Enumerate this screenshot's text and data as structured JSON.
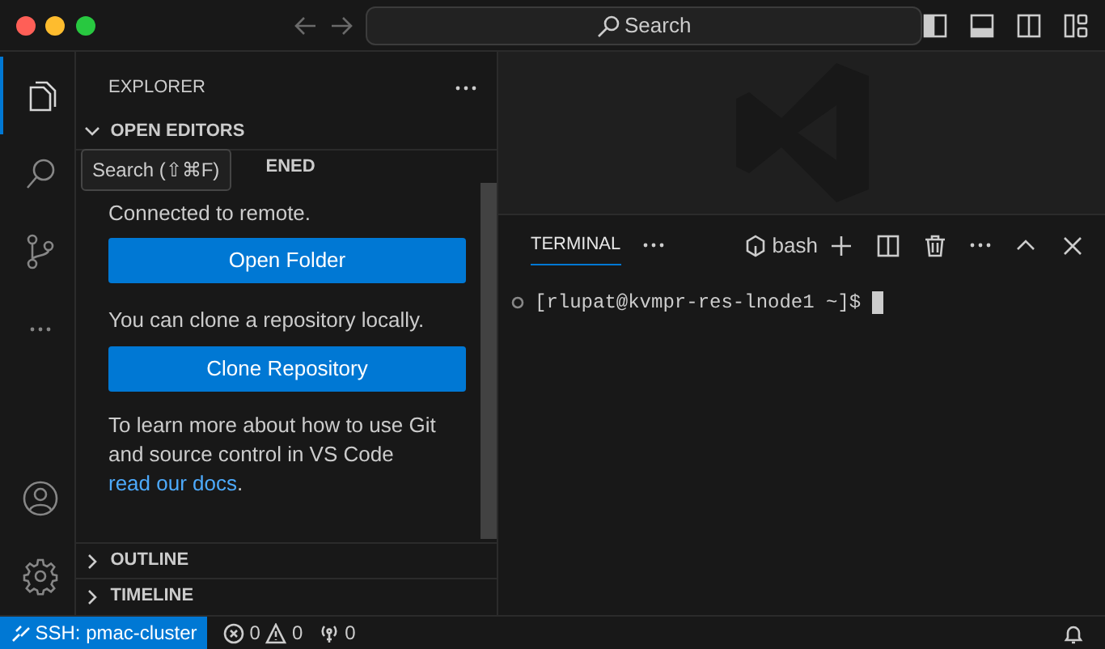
{
  "title_bar": {
    "search": {
      "placeholder": "Search"
    }
  },
  "activity_bar": {
    "items": [
      {
        "kind": "explorer",
        "selected": true
      },
      {
        "kind": "search",
        "selected": false
      },
      {
        "kind": "source-control",
        "selected": false
      },
      {
        "kind": "more",
        "selected": false
      }
    ],
    "bottom_items": [
      {
        "kind": "account",
        "selected": false
      },
      {
        "kind": "manage",
        "selected": false
      }
    ]
  },
  "tooltip": "Search (⇧⌘F)",
  "sidebar": {
    "title": "EXPLORER",
    "sections": [
      {
        "title": "OPEN EDITORS",
        "expanded": true
      },
      {
        "title": "ENED"
      }
    ],
    "welcome": {
      "message": "Connected to remote.",
      "open_button": "Open Folder",
      "clone_message": "You can clone a repository locally.",
      "clone_button": "Clone Repository",
      "help_text": "To learn more about how to use Git and source control in VS Code ",
      "help_link": "read our docs",
      "help_end": "."
    },
    "bottom_sections": [
      {
        "title": "OUTLINE",
        "expanded": false
      },
      {
        "title": "TIMELINE",
        "expanded": false
      }
    ]
  },
  "panel": {
    "tabs": [
      {
        "label": "TERMINAL",
        "selected": true
      }
    ],
    "shell": "bash",
    "terminal_line": "[rlupat@kvmpr-res-lnode1 ~]$"
  },
  "status_bar": {
    "remote": "SSH: pmac-cluster",
    "errors": "0",
    "warnings": "0",
    "ports": "0"
  }
}
